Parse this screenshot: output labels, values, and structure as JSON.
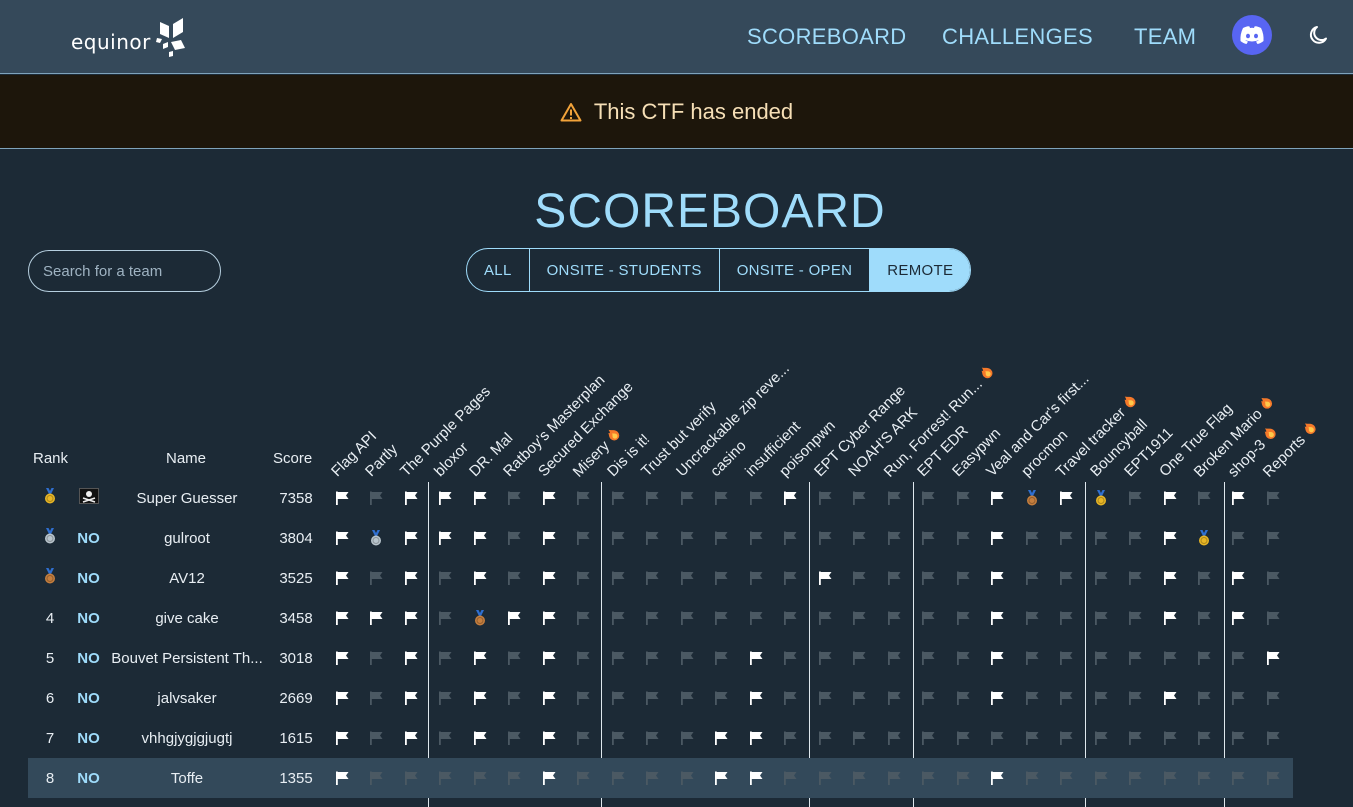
{
  "header": {
    "logo_text": "equinor",
    "nav": [
      "SCOREBOARD",
      "CHALLENGES",
      "TEAM"
    ],
    "discord_icon": "discord-icon",
    "theme_icon": "moon-icon"
  },
  "banner": {
    "icon": "warning-icon",
    "text": "This CTF has ended"
  },
  "page_title": "SCOREBOARD",
  "search": {
    "placeholder": "Search for a team",
    "value": ""
  },
  "filters": [
    {
      "label": "ALL",
      "active": false
    },
    {
      "label": "ONSITE - STUDENTS",
      "active": false
    },
    {
      "label": "ONSITE - OPEN",
      "active": false
    },
    {
      "label": "REMOTE",
      "active": true
    }
  ],
  "columns": {
    "rank": "Rank",
    "name": "Name",
    "score": "Score"
  },
  "challenges": [
    {
      "name": "Flag API",
      "fire": false
    },
    {
      "name": "Partly",
      "fire": false
    },
    {
      "name": "The Purple Pages",
      "fire": false
    },
    {
      "name": "bloxor",
      "fire": false
    },
    {
      "name": "DR. Mal",
      "fire": false
    },
    {
      "name": "Ratboy's Masterplan",
      "fire": false
    },
    {
      "name": "Secured Exchange",
      "fire": false
    },
    {
      "name": "Misery",
      "fire": true
    },
    {
      "name": "Dis is it!",
      "fire": false
    },
    {
      "name": "Trust but verify",
      "fire": false
    },
    {
      "name": "Uncrackable zip reve...",
      "fire": false
    },
    {
      "name": "casino",
      "fire": false
    },
    {
      "name": "insufficient",
      "fire": false
    },
    {
      "name": "poisonpwn",
      "fire": false
    },
    {
      "name": "EPT Cyber Range",
      "fire": false
    },
    {
      "name": "NOAH'S ARK",
      "fire": false
    },
    {
      "name": "Run, Forrest! Run...",
      "fire": true
    },
    {
      "name": "EPT EDR",
      "fire": false
    },
    {
      "name": "Easypwn",
      "fire": false
    },
    {
      "name": "Veal and Car's first...",
      "fire": false
    },
    {
      "name": "procmon",
      "fire": false
    },
    {
      "name": "Travel tracker",
      "fire": true
    },
    {
      "name": "Bouncyball",
      "fire": false
    },
    {
      "name": "EPT1911",
      "fire": false
    },
    {
      "name": "One True Flag",
      "fire": false
    },
    {
      "name": "Broken Mario",
      "fire": true
    },
    {
      "name": "shop-3",
      "fire": true
    },
    {
      "name": "Reports",
      "fire": true
    }
  ],
  "rows": [
    {
      "rank": "",
      "rank_medal": "gold",
      "country": "",
      "country_icon": "pirate-flag-icon",
      "name": "Super Guesser",
      "score": "7358",
      "solves": "WdWWWdWddddddWdddddWbWgdWdWdd"
    },
    {
      "rank": "",
      "rank_medal": "silver",
      "country": "NO",
      "name": "gulroot",
      "score": "3804",
      "solves": "WsWWWdWddddddddddddWddddWgddd"
    },
    {
      "rank": "",
      "rank_medal": "bronze",
      "country": "NO",
      "name": "AV12",
      "score": "3525",
      "solves": "WdWdWdWdddddddWddddWddddWdWdd"
    },
    {
      "rank": "4",
      "country": "NO",
      "name": "give cake",
      "score": "3458",
      "solves": "WWWdbWWddddddddddddWddddWdWdd"
    },
    {
      "rank": "5",
      "country": "NO",
      "name": "Bouvet Persistent Th...",
      "score": "3018",
      "solves": "WdWdWdWdddddWddddddWdddddddWd"
    },
    {
      "rank": "6",
      "country": "NO",
      "name": "jalvsaker",
      "score": "2669",
      "solves": "WdWdWdWdddddWddddddWddddWdddd"
    },
    {
      "rank": "7",
      "country": "NO",
      "name": "vhhgjygjgjugtj",
      "score": "1615",
      "solves": "WdWdWdWddddWWddddddddddddddddd"
    },
    {
      "rank": "8",
      "country": "NO",
      "name": "Toffe",
      "score": "1355",
      "solves": "WdddddWddddWWddddddWddddddddd",
      "highlight": true
    }
  ],
  "colors": {
    "accent": "#9fdcfb",
    "background": "#1c2a36",
    "header": "#35495a",
    "banner": "#1d160b"
  }
}
